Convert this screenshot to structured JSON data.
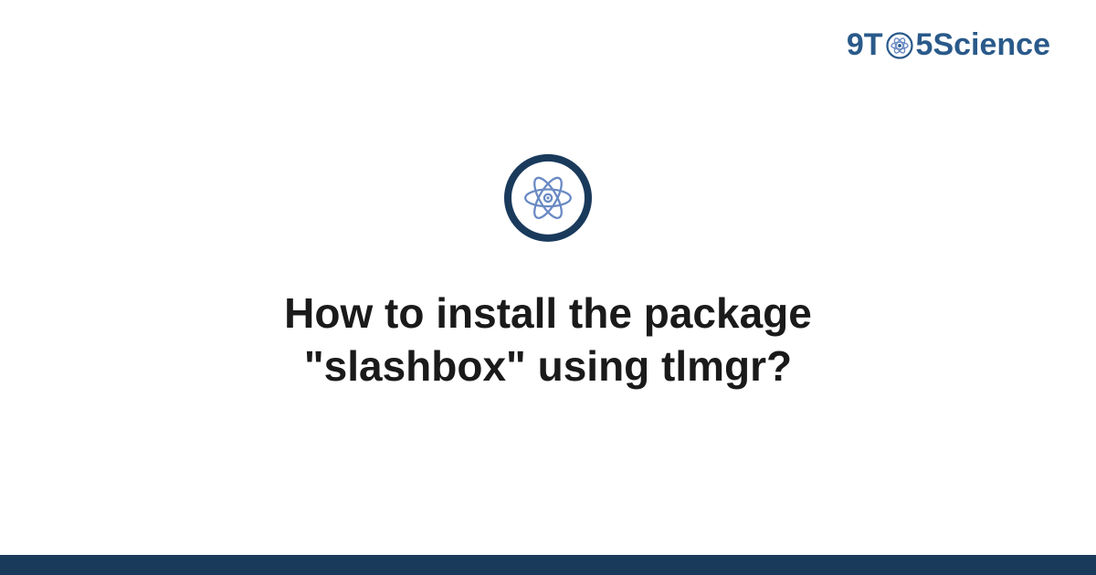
{
  "brand": {
    "prefix": "9T",
    "middle_icon": "atom-icon",
    "suffix": "5Science"
  },
  "main": {
    "badge_icon": "atom-icon",
    "question": "How to install the package \"slashbox\" using tlmgr?"
  },
  "colors": {
    "brand_blue": "#2a5a8a",
    "dark_navy": "#1a3a5c",
    "atom_light": "#6a8ac4"
  }
}
